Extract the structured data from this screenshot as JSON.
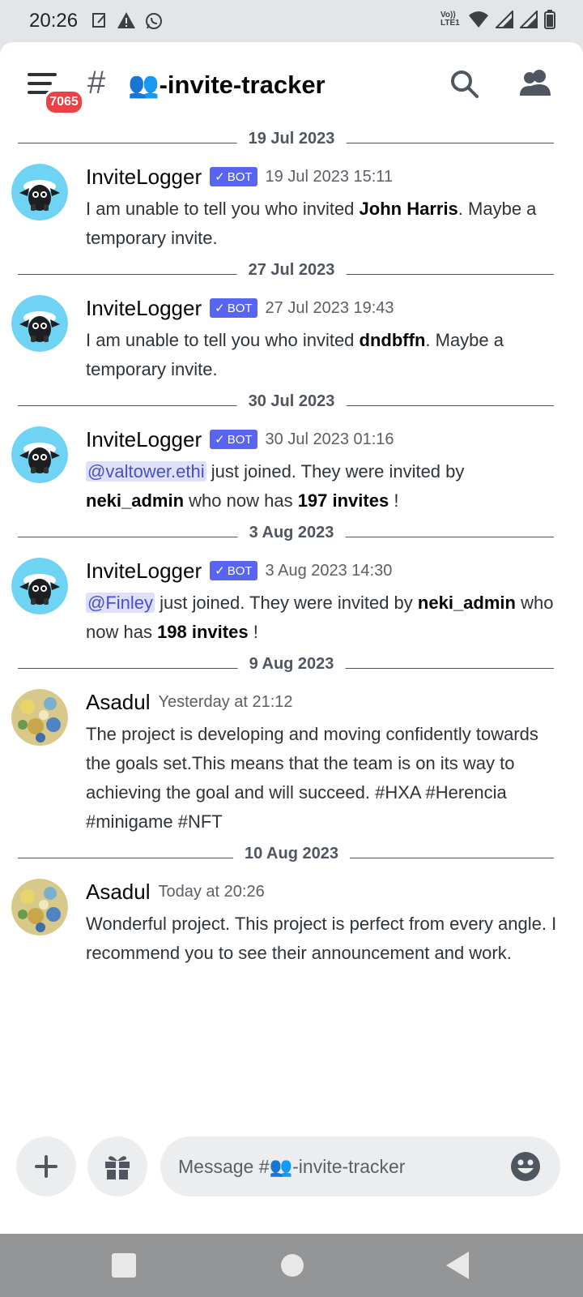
{
  "status_bar": {
    "time": "20:26",
    "left_icons": [
      "notification-edit-icon",
      "warning-icon",
      "whatsapp-icon"
    ],
    "right_icons": [
      "volte-icon",
      "wifi-icon",
      "signal-icon",
      "signal-icon",
      "battery-icon"
    ],
    "volte_label": "Vo))\nLTE1"
  },
  "header": {
    "badge_count": "7065",
    "hash": "#",
    "channel_name": "👥-invite-tracker"
  },
  "messages": [
    {
      "date": "19 Jul 2023",
      "author": "InviteLogger",
      "bot": true,
      "bot_label": "BOT",
      "timestamp": "19 Jul 2023 15:11",
      "segments": [
        {
          "t": "I am unable to tell you who invited "
        },
        {
          "t": "John Harris",
          "bold": true
        },
        {
          "t": ". Maybe a temporary invite."
        }
      ]
    },
    {
      "date": "27 Jul 2023",
      "author": "InviteLogger",
      "bot": true,
      "bot_label": "BOT",
      "timestamp": "27 Jul 2023 19:43",
      "segments": [
        {
          "t": "I am unable to tell you who invited "
        },
        {
          "t": "dndbffn",
          "bold": true
        },
        {
          "t": ". Maybe a temporary invite."
        }
      ]
    },
    {
      "date": "30 Jul 2023",
      "author": "InviteLogger",
      "bot": true,
      "bot_label": "BOT",
      "timestamp": "30 Jul 2023 01:16",
      "segments": [
        {
          "t": "@valtower.ethi",
          "mention": true
        },
        {
          "t": " just joined. They were invited by "
        },
        {
          "t": "neki_admin",
          "bold": true
        },
        {
          "t": " who now has "
        },
        {
          "t": "197 invites",
          "bold": true
        },
        {
          "t": " !"
        }
      ]
    },
    {
      "date": "3 Aug 2023",
      "author": "InviteLogger",
      "bot": true,
      "bot_label": "BOT",
      "timestamp": "3 Aug 2023 14:30",
      "segments": [
        {
          "t": "@Finley",
          "mention": true
        },
        {
          "t": " just joined. They were invited by "
        },
        {
          "t": "neki_admin",
          "bold": true
        },
        {
          "t": " who now has "
        },
        {
          "t": "198 invites",
          "bold": true
        },
        {
          "t": " !"
        }
      ]
    },
    {
      "date": "9 Aug 2023",
      "author": "Asadul",
      "bot": false,
      "timestamp": "Yesterday at 21:12",
      "segments": [
        {
          "t": "The project is developing and moving confidently towards the goals set.This means that the team is on its way to achieving the goal and will succeed. #HXA #Herencia #minigame #NFT"
        }
      ]
    },
    {
      "date": "10 Aug 2023",
      "author": "Asadul",
      "bot": false,
      "timestamp": "Today at 20:26",
      "segments": [
        {
          "t": "Wonderful project. This project is perfect from every angle. I recommend you to see their announcement and work."
        }
      ]
    }
  ],
  "composer": {
    "placeholder": "Message #👥-invite-tracker"
  },
  "colors": {
    "accent": "#5865f2",
    "badge": "#ed4245",
    "mention_bg": "#dee0fc",
    "mention_text": "#4752c4"
  }
}
